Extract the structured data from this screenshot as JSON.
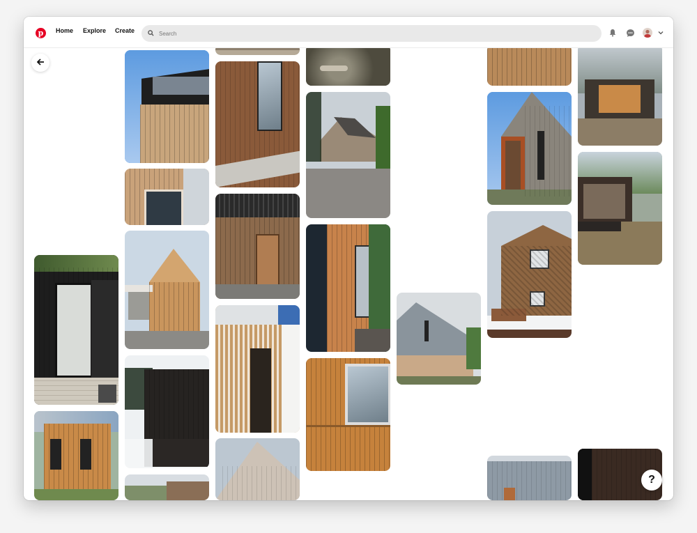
{
  "header": {
    "logo_letter": "p",
    "nav": [
      "Home",
      "Explore",
      "Create"
    ],
    "search_placeholder": "Search"
  },
  "icons": {
    "logo": "pinterest-logo",
    "search": "search-icon",
    "notifications": "bell-icon",
    "messages": "chat-icon",
    "profile": "avatar",
    "account_menu": "chevron-down-icon",
    "back": "arrow-left-icon",
    "help": "question-icon"
  },
  "help_label": "?",
  "colors": {
    "brand": "#e60023",
    "search_bg": "#e9e9e9"
  },
  "pins": [
    {
      "subject": "charred timber cabin with glass door"
    },
    {
      "subject": "small larch clad garden office"
    },
    {
      "subject": "standing seam timber roof against blue sky"
    },
    {
      "subject": "timber siding and window corner"
    },
    {
      "subject": "gabled house with timber cladding"
    },
    {
      "subject": "charred timber shed in snow"
    },
    {
      "subject": "house gable under sky"
    },
    {
      "subject": "vertical board cladding with window"
    },
    {
      "subject": "timber entrance with dark roof"
    },
    {
      "subject": "slatted timber facade with door"
    },
    {
      "subject": "pale timber gable"
    },
    {
      "subject": "garden path with stones"
    },
    {
      "subject": "barn house on gravel"
    },
    {
      "subject": "timber window box and deck"
    },
    {
      "subject": "timber boards with window"
    },
    {
      "subject": "long house with metal and timber facade"
    },
    {
      "subject": "vertical timber cladding"
    },
    {
      "subject": "weathered timber cabin with corten log store"
    },
    {
      "subject": "shingled timber house in winter"
    },
    {
      "subject": "grey metal clad houses"
    },
    {
      "subject": "timber pavilion in forest"
    },
    {
      "subject": "dark timber cabin in bushland"
    },
    {
      "subject": "dark timber wall"
    }
  ]
}
